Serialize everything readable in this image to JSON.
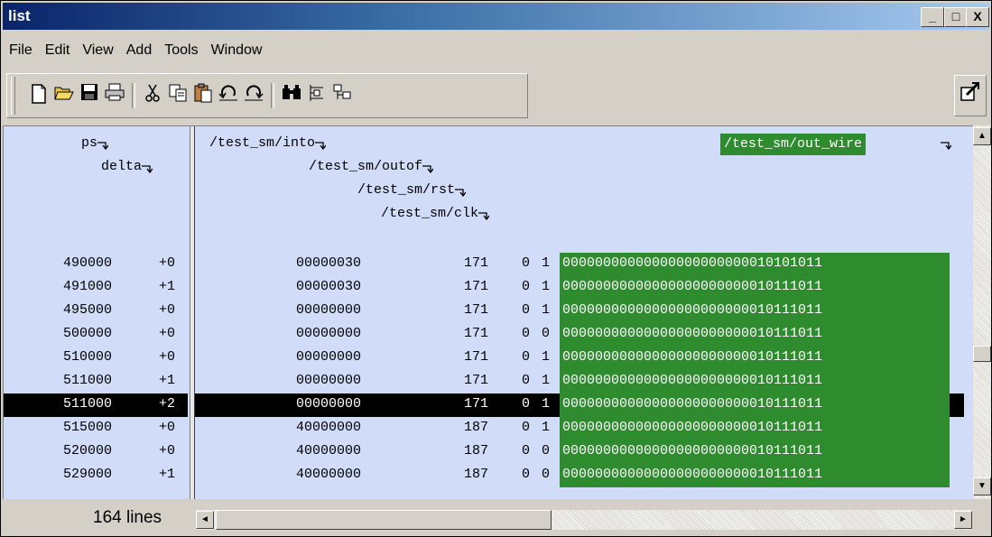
{
  "window": {
    "title": "list"
  },
  "title_buttons": {
    "minimize": "_",
    "maximize": "□",
    "close": "X"
  },
  "menu": [
    "File",
    "Edit",
    "View",
    "Add",
    "Tools",
    "Window"
  ],
  "toolbar_icons": [
    "new-icon",
    "open-icon",
    "save-icon",
    "print-icon",
    "cut-icon",
    "copy-icon",
    "paste-icon",
    "undo-icon",
    "redo-icon",
    "find-icon",
    "combine-icon",
    "split-icon"
  ],
  "headers": {
    "ps": "ps",
    "delta": "delta",
    "into": "/test_sm/into",
    "outof": "/test_sm/outof",
    "rst": "/test_sm/rst",
    "clk": "/test_sm/clk",
    "out_wire": "/test_sm/out_wire"
  },
  "rows": [
    {
      "ps": "490000",
      "delta": "+0",
      "into": "00000030",
      "outof": "171",
      "rst": "0",
      "clk": "1",
      "out_wire": "00000000000000000000000010101011",
      "selected": false
    },
    {
      "ps": "491000",
      "delta": "+1",
      "into": "00000030",
      "outof": "171",
      "rst": "0",
      "clk": "1",
      "out_wire": "00000000000000000000000010111011",
      "selected": false
    },
    {
      "ps": "495000",
      "delta": "+0",
      "into": "00000000",
      "outof": "171",
      "rst": "0",
      "clk": "1",
      "out_wire": "00000000000000000000000010111011",
      "selected": false
    },
    {
      "ps": "500000",
      "delta": "+0",
      "into": "00000000",
      "outof": "171",
      "rst": "0",
      "clk": "0",
      "out_wire": "00000000000000000000000010111011",
      "selected": false
    },
    {
      "ps": "510000",
      "delta": "+0",
      "into": "00000000",
      "outof": "171",
      "rst": "0",
      "clk": "1",
      "out_wire": "00000000000000000000000010111011",
      "selected": false
    },
    {
      "ps": "511000",
      "delta": "+1",
      "into": "00000000",
      "outof": "171",
      "rst": "0",
      "clk": "1",
      "out_wire": "00000000000000000000000010111011",
      "selected": false
    },
    {
      "ps": "511000",
      "delta": "+2",
      "into": "00000000",
      "outof": "171",
      "rst": "0",
      "clk": "1",
      "out_wire": "00000000000000000000000010111011",
      "selected": true
    },
    {
      "ps": "515000",
      "delta": "+0",
      "into": "40000000",
      "outof": "187",
      "rst": "0",
      "clk": "1",
      "out_wire": "00000000000000000000000010111011",
      "selected": false
    },
    {
      "ps": "520000",
      "delta": "+0",
      "into": "40000000",
      "outof": "187",
      "rst": "0",
      "clk": "0",
      "out_wire": "00000000000000000000000010111011",
      "selected": false
    },
    {
      "ps": "529000",
      "delta": "+1",
      "into": "40000000",
      "outof": "187",
      "rst": "0",
      "clk": "0",
      "out_wire": "00000000000000000000000010111011",
      "selected": false
    }
  ],
  "status": {
    "lines": "164 lines"
  },
  "colors": {
    "wave_bg": "#d0dcf8",
    "highlight": "#2e8b2e",
    "selection": "#000000"
  }
}
